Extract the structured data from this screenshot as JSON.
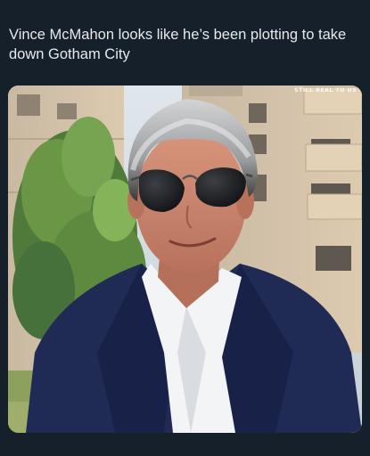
{
  "post": {
    "text": "Vince McMahon looks like he’s been plotting to take down Gotham City"
  },
  "media": {
    "watermark": "STILL REAL TO US"
  }
}
